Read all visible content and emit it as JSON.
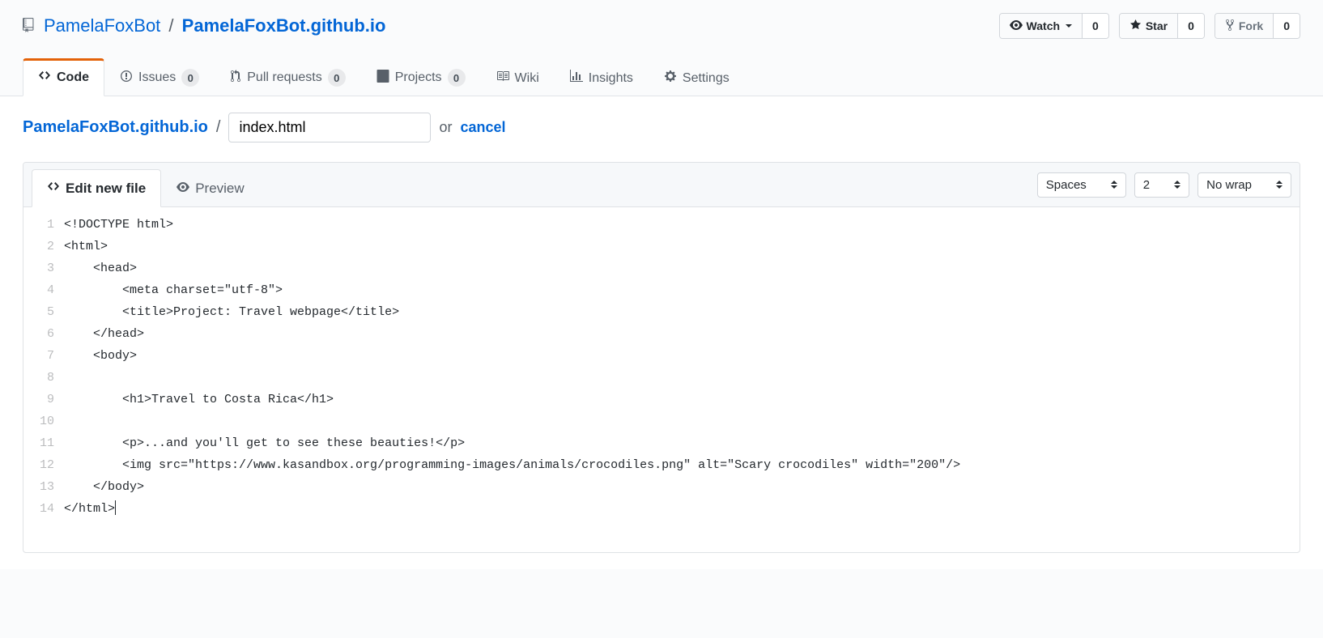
{
  "repo": {
    "owner": "PamelaFoxBot",
    "name": "PamelaFoxBot.github.io"
  },
  "actions": {
    "watch": {
      "label": "Watch",
      "count": "0"
    },
    "star": {
      "label": "Star",
      "count": "0"
    },
    "fork": {
      "label": "Fork",
      "count": "0"
    }
  },
  "tabs": {
    "code": "Code",
    "issues": {
      "label": "Issues",
      "count": "0"
    },
    "pulls": {
      "label": "Pull requests",
      "count": "0"
    },
    "projects": {
      "label": "Projects",
      "count": "0"
    },
    "wiki": "Wiki",
    "insights": "Insights",
    "settings": "Settings"
  },
  "path": {
    "repo_link": "PamelaFoxBot.github.io",
    "filename": "index.html",
    "or": "or",
    "cancel": "cancel"
  },
  "editor_tabs": {
    "edit": "Edit new file",
    "preview": "Preview"
  },
  "editor_controls": {
    "indent": "Spaces",
    "indent_size": "2",
    "wrap": "No wrap"
  },
  "code": {
    "lines": [
      "<!DOCTYPE html>",
      "<html>",
      "    <head>",
      "        <meta charset=\"utf-8\">",
      "        <title>Project: Travel webpage</title>",
      "    </head>",
      "    <body>",
      "",
      "        <h1>Travel to Costa Rica</h1>",
      "",
      "        <p>...and you'll get to see these beauties!</p>",
      "        <img src=\"https://www.kasandbox.org/programming-images/animals/crocodiles.png\" alt=\"Scary crocodiles\" width=\"200\"/>",
      "    </body>",
      "</html>"
    ],
    "line_numbers": [
      "1",
      "2",
      "3",
      "4",
      "5",
      "6",
      "7",
      "8",
      "9",
      "10",
      "11",
      "12",
      "13",
      "14"
    ]
  }
}
